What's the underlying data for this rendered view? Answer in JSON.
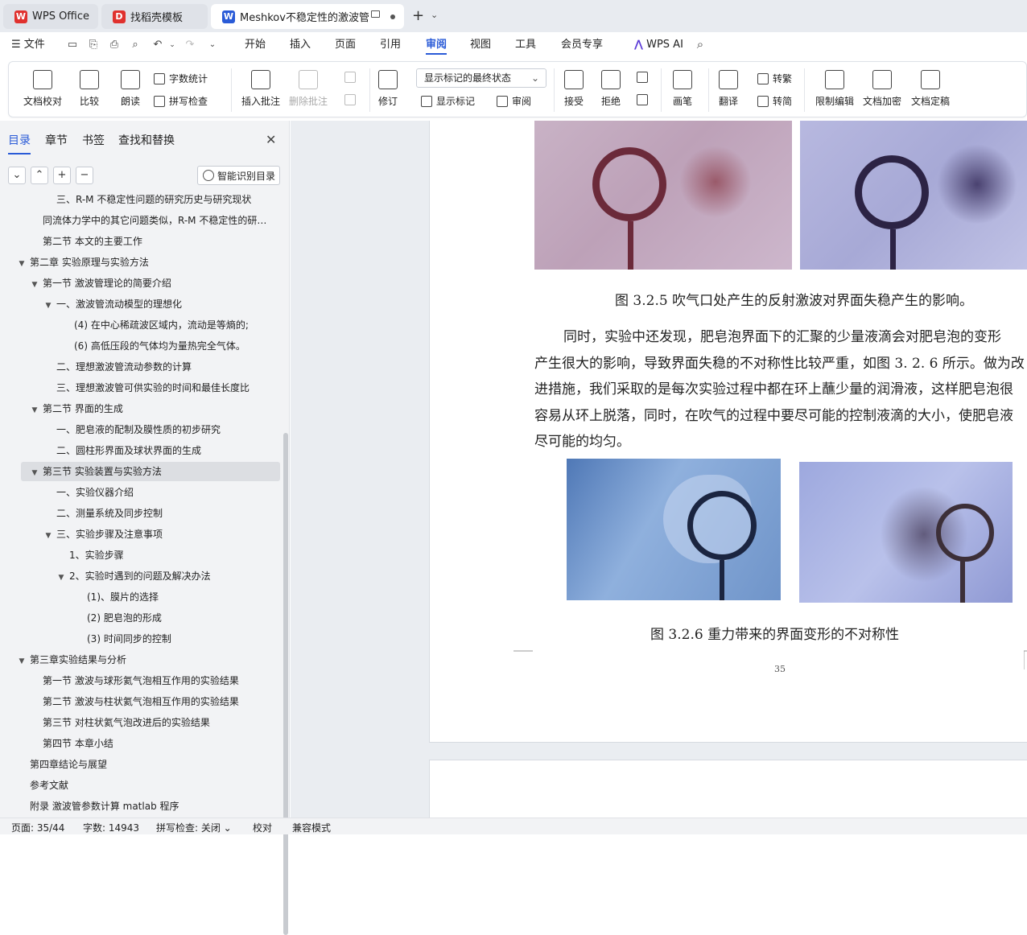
{
  "tabs": [
    {
      "label": "WPS Office"
    },
    {
      "label": "找稻壳模板"
    },
    {
      "label": "Meshkov不稳定性的激波管实"
    }
  ],
  "menu": {
    "file": "文件",
    "items": [
      "开始",
      "插入",
      "页面",
      "引用",
      "审阅",
      "视图",
      "工具",
      "会员专享"
    ],
    "active": "审阅",
    "wps_ai": "WPS AI"
  },
  "ribbon": {
    "doc_check": "文档校对",
    "compare": "比较",
    "read_aloud": "朗读",
    "word_count": "字数统计",
    "spell_check": "拼写检查",
    "insert_comment": "插入批注",
    "delete_comment": "删除批注",
    "revise": "修订",
    "display_state": "显示标记的最终状态",
    "show_markup": "显示标记",
    "review": "审阅",
    "accept": "接受",
    "reject": "拒绝",
    "pen": "画笔",
    "translate": "翻译",
    "to_traditional": "转繁",
    "to_simplified": "转简",
    "restrict_edit": "限制编辑",
    "encrypt": "文档加密",
    "finalize": "文档定稿"
  },
  "panel": {
    "tabs": [
      "目录",
      "章节",
      "书签",
      "查找和替换"
    ],
    "smart_toc": "智能识别目录",
    "toc": [
      {
        "text": "三、R-M 不稳定性问题的研究历史与研究现状",
        "indent": 70
      },
      {
        "text": "同流体力学中的其它问题类似，R-M 不稳定性的研…",
        "indent": 53
      },
      {
        "text": "第二节    本文的主要工作",
        "indent": 53
      },
      {
        "text": "第二章   实验原理与实验方法",
        "indent": 37,
        "arrow": true
      },
      {
        "text": "第一节  激波管理论的简要介绍",
        "indent": 53,
        "arrow": true
      },
      {
        "text": "一、激波管流动模型的理想化",
        "indent": 70,
        "arrow": true
      },
      {
        "text": "(4) 在中心稀疏波区域内，流动是等熵的;",
        "indent": 92
      },
      {
        "text": "(6) 高低压段的气体均为量热完全气体。",
        "indent": 92
      },
      {
        "text": "二、理想激波管流动参数的计算",
        "indent": 70
      },
      {
        "text": "三、理想激波管可供实验的时间和最佳长度比",
        "indent": 70
      },
      {
        "text": "第二节   界面的生成",
        "indent": 53,
        "arrow": true
      },
      {
        "text": "一、肥皂液的配制及膜性质的初步研究",
        "indent": 70
      },
      {
        "text": "二、圆柱形界面及球状界面的生成",
        "indent": 70
      },
      {
        "text": "第三节   实验装置与实验方法",
        "indent": 53,
        "arrow": true,
        "selected": true
      },
      {
        "text": "一、实验仪器介绍",
        "indent": 70
      },
      {
        "text": "二、测量系统及同步控制",
        "indent": 70
      },
      {
        "text": "三、实验步骤及注意事项",
        "indent": 70,
        "arrow": true
      },
      {
        "text": "1、实验步骤",
        "indent": 86
      },
      {
        "text": "2、实验时遇到的问题及解决办法",
        "indent": 86,
        "arrow": true
      },
      {
        "text": "(1)、膜片的选择",
        "indent": 108
      },
      {
        "text": "(2) 肥皂泡的形成",
        "indent": 108
      },
      {
        "text": "(3) 时间同步的控制",
        "indent": 108
      },
      {
        "text": "第三章实验结果与分析",
        "indent": 37,
        "arrow": true
      },
      {
        "text": "第一节   激波与球形氦气泡相互作用的实验结果",
        "indent": 53
      },
      {
        "text": "第二节   激波与柱状氦气泡相互作用的实验结果",
        "indent": 53
      },
      {
        "text": "第三节   对柱状氦气泡改进后的实验结果",
        "indent": 53
      },
      {
        "text": "第四节     本章小结",
        "indent": 53
      },
      {
        "text": "第四章结论与展望",
        "indent": 37
      },
      {
        "text": "参考文献",
        "indent": 37
      },
      {
        "text": "附录   激波管参数计算 matlab 程序",
        "indent": 37
      }
    ]
  },
  "document": {
    "caption_325": "图 3.2.5   吹气口处产生的反射激波对界面失稳产生的影响。",
    "paragraph_lines": [
      "同时，实验中还发现，肥皂泡界面下的汇聚的少量液滴会对肥皂泡的变形",
      "产生很大的影响，导致界面失稳的不对称性比较严重，如图 3. 2. 6 所示。做为改",
      "进措施，我们采取的是每次实验过程中都在环上蘸少量的润滑液，这样肥皂泡很",
      "容易从环上脱落，同时，在吹气的过程中要尽可能的控制液滴的大小，使肥皂液",
      "尽可能的均匀。"
    ],
    "caption_326": "图 3.2.6    重力带来的界面变形的不对称性",
    "page_number": "35"
  },
  "status": {
    "page": "页面: 35/44",
    "words": "字数: 14943",
    "spell": "拼写检查: 关闭",
    "proof": "校对",
    "compat": "兼容模式"
  }
}
